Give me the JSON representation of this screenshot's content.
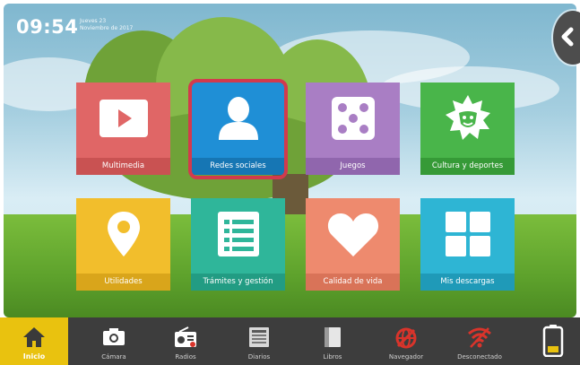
{
  "status": {
    "time": "09:54",
    "date_line1": "Jueves 23",
    "date_line2": "Noviembre de 2017"
  },
  "tiles": [
    {
      "label": "Multimedia",
      "icon": "play-icon",
      "color": "#e06666"
    },
    {
      "label": "Redes sociales",
      "icon": "person-icon",
      "color": "#1f8fd6",
      "selected": true
    },
    {
      "label": "Juegos",
      "icon": "dice-icon",
      "color": "#a97ec4"
    },
    {
      "label": "Cultura y deportes",
      "icon": "theater-mask-icon",
      "color": "#49b54a"
    },
    {
      "label": "Utilidades",
      "icon": "location-pin-icon",
      "color": "#f2be2c"
    },
    {
      "label": "Trámites y gestión",
      "icon": "list-document-icon",
      "color": "#2fb69a"
    },
    {
      "label": "Calidad de vida",
      "icon": "heart-icon",
      "color": "#ee8a6e"
    },
    {
      "label": "Mis descargas",
      "icon": "grid-icon",
      "color": "#2eb5d4"
    }
  ],
  "taskbar": [
    {
      "label": "Inicio",
      "icon": "home-icon"
    },
    {
      "label": "Cámara",
      "icon": "camera-icon"
    },
    {
      "label": "Radios",
      "icon": "radio-icon"
    },
    {
      "label": "Diarios",
      "icon": "newspaper-icon"
    },
    {
      "label": "Libros",
      "icon": "book-icon"
    },
    {
      "label": "Navegador",
      "icon": "browser-icon"
    },
    {
      "label": "Desconectado",
      "icon": "wifi-off-icon"
    }
  ],
  "colors": {
    "taskbar": "#3d3d3d",
    "home_active": "#e9c20f",
    "selection_ring": "#d23a4d",
    "alert_red": "#d9342b"
  }
}
